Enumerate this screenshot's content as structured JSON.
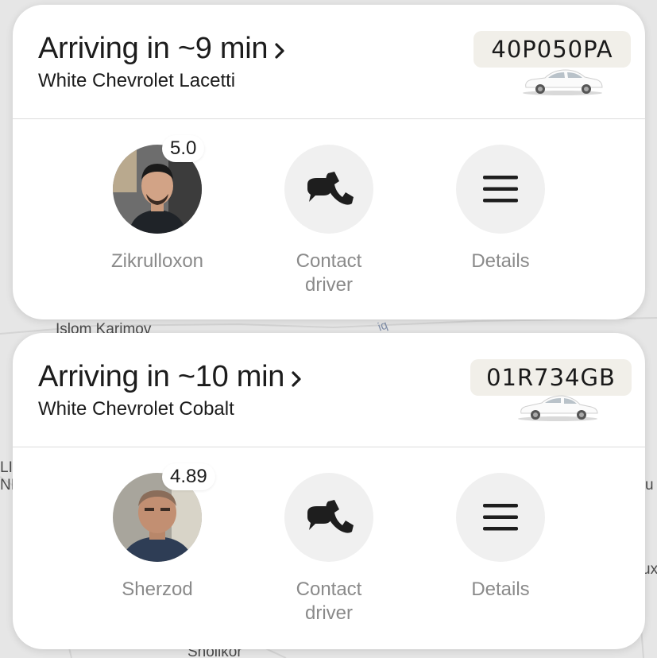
{
  "map": {
    "labels": [
      "Islom Karimov",
      "Sholikor",
      "iq",
      "LI",
      "NI",
      "u",
      "ux"
    ]
  },
  "rides": [
    {
      "eta_title": "Arriving in ~9 min",
      "car_model": "White Chevrolet Lacetti",
      "plate": "40P050PA",
      "driver_name": "Zikrulloxon",
      "rating": "5.0",
      "contact_label_1": "Contact",
      "contact_label_2": "driver",
      "details_label": "Details"
    },
    {
      "eta_title": "Arriving in ~10 min",
      "car_model": "White Chevrolet Cobalt",
      "plate": "01R734GB",
      "driver_name": "Sherzod",
      "rating": "4.89",
      "contact_label_1": "Contact",
      "contact_label_2": "driver",
      "details_label": "Details"
    }
  ],
  "colors": {
    "card_bg": "#ffffff",
    "plate_bg": "#f1efe9",
    "action_bg": "#f0f0f0",
    "label_gray": "#8a8a8a",
    "map_bg": "#e6e6e6"
  },
  "icons": {
    "chevron": "chevron-right-icon",
    "contact": "chat-phone-icon",
    "details": "menu-icon",
    "car": "car-icon"
  }
}
